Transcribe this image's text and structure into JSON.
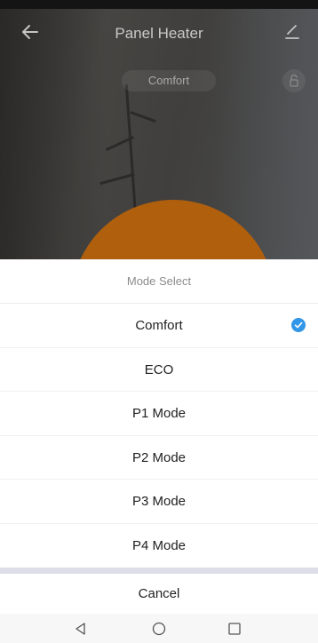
{
  "app": {
    "title": "Panel Heater",
    "current_mode": "Comfort"
  },
  "icons": {
    "back": "arrow-left-icon",
    "edit": "pencil-icon",
    "lock": "unlock-icon",
    "selected": "check-circle-icon"
  },
  "sheet": {
    "title": "Mode Select",
    "options": [
      {
        "label": "Comfort",
        "selected": true
      },
      {
        "label": "ECO",
        "selected": false
      },
      {
        "label": "P1 Mode",
        "selected": false
      },
      {
        "label": "P2 Mode",
        "selected": false
      },
      {
        "label": "P3 Mode",
        "selected": false
      },
      {
        "label": "P4 Mode",
        "selected": false
      }
    ],
    "cancel_label": "Cancel"
  },
  "colors": {
    "accent_check": "#3196e8",
    "dial_orange": "#b05f0d"
  }
}
